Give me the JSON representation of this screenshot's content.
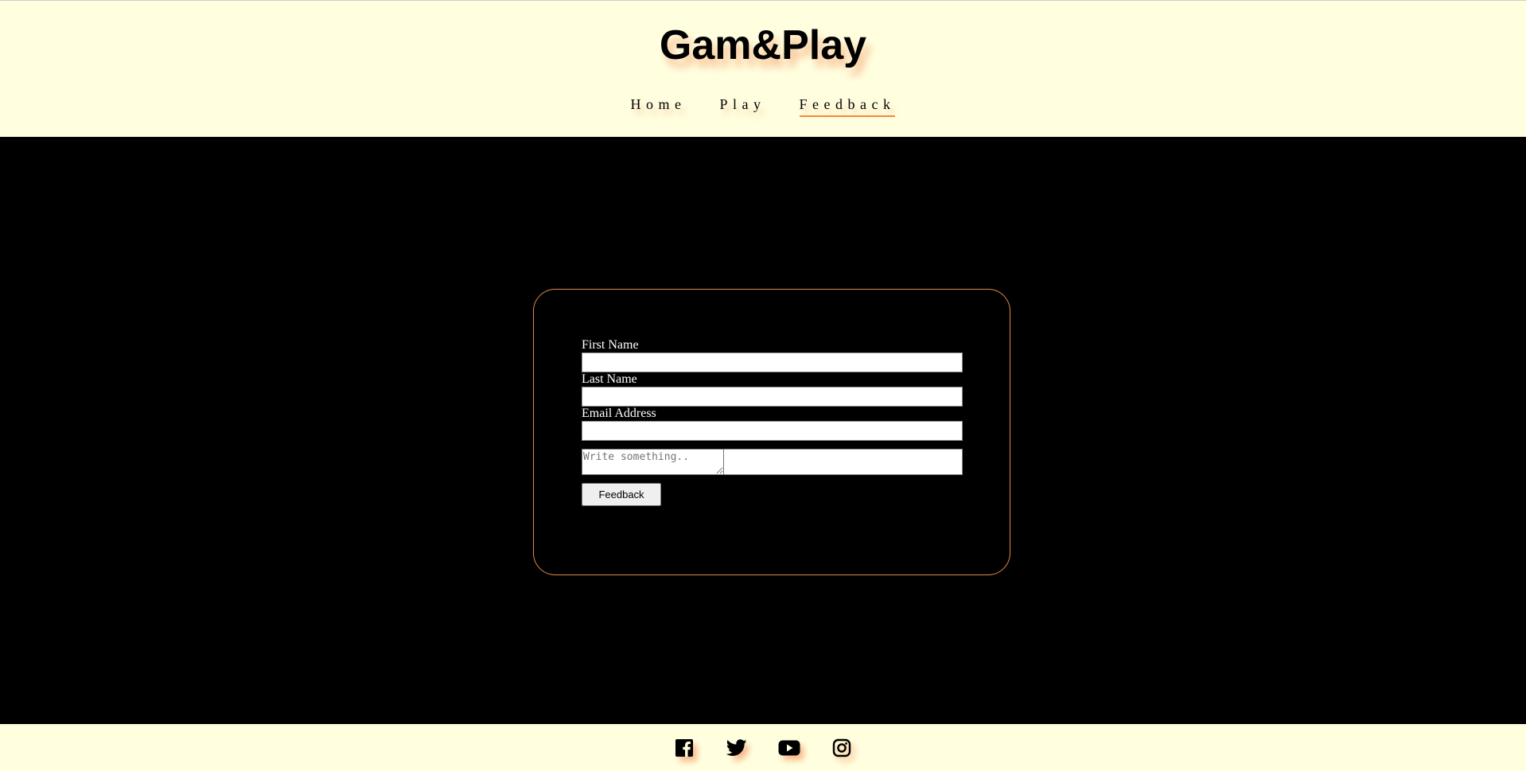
{
  "header": {
    "logo": "Gam&Play",
    "nav": [
      {
        "label": "Home"
      },
      {
        "label": "Play"
      },
      {
        "label": "Feedback",
        "active": true
      }
    ]
  },
  "form": {
    "first_name_label": "First Name",
    "last_name_label": "Last Name",
    "email_label": "Email Address",
    "first_name_value": "",
    "last_name_value": "",
    "email_value": "",
    "message_placeholder": "Write something..",
    "submit_label": "Feedback"
  },
  "footer": {
    "icons": [
      "facebook-icon",
      "twitter-icon",
      "youtube-icon",
      "instagram-icon"
    ]
  },
  "colors": {
    "header_bg": "#ffffe0",
    "main_bg": "#000000",
    "accent": "#f28a3c",
    "card_border": "#e5874a"
  }
}
